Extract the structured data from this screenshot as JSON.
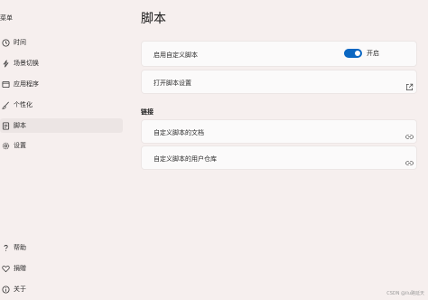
{
  "sidebar": {
    "header": "菜单",
    "items": [
      {
        "label": "时间",
        "icon": "clock-icon"
      },
      {
        "label": "场景切换",
        "icon": "lightning-icon"
      },
      {
        "label": "应用程序",
        "icon": "app-icon"
      },
      {
        "label": "个性化",
        "icon": "brush-icon"
      },
      {
        "label": "脚本",
        "icon": "script-icon"
      },
      {
        "label": "设置",
        "icon": "gear-icon"
      }
    ],
    "bottom_items": [
      {
        "label": "帮助",
        "icon": "help-icon"
      },
      {
        "label": "捐赠",
        "icon": "heart-icon"
      },
      {
        "label": "关于",
        "icon": "info-icon"
      }
    ]
  },
  "main": {
    "title": "脚本",
    "enable_row": {
      "label": "启用自定义脚本",
      "toggle_state": "开启",
      "toggle_on": true
    },
    "settings_row": {
      "label": "打开脚本设置"
    },
    "links_section": {
      "title": "链接",
      "items": [
        {
          "label": "自定义脚本的文档"
        },
        {
          "label": "自定义脚本的用户仓库"
        }
      ]
    }
  },
  "watermark": "CSDN @ilu路延天",
  "colors": {
    "accent": "#0a67c2",
    "background": "#f6efee",
    "card": "#fbfafa"
  }
}
